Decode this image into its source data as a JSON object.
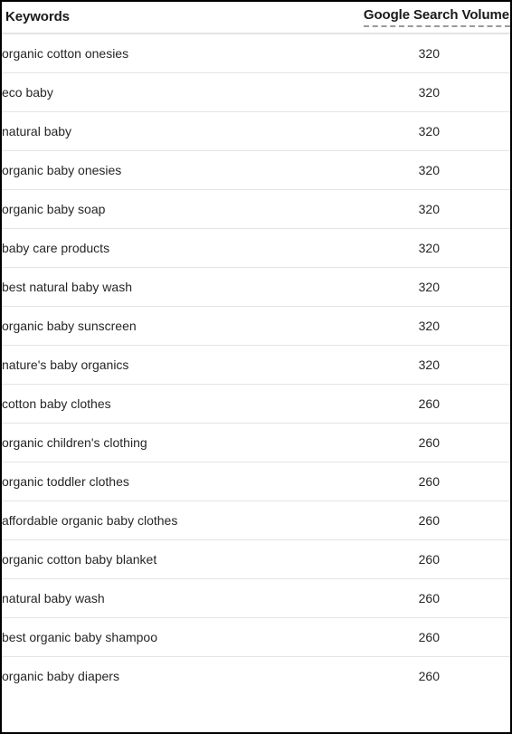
{
  "table": {
    "columns": [
      {
        "key": "keyword",
        "label": "Keywords",
        "align": "left"
      },
      {
        "key": "volume",
        "label": "Google Search Volume",
        "align": "center"
      }
    ],
    "header": {
      "keywords_label": "Keywords",
      "volume_label": "Google Search Volume"
    },
    "rows": [
      {
        "keyword": "organic cotton onesies",
        "volume": "320"
      },
      {
        "keyword": "eco baby",
        "volume": "320"
      },
      {
        "keyword": "natural baby",
        "volume": "320"
      },
      {
        "keyword": "organic baby onesies",
        "volume": "320"
      },
      {
        "keyword": "organic baby soap",
        "volume": "320"
      },
      {
        "keyword": "baby care products",
        "volume": "320"
      },
      {
        "keyword": "best natural baby wash",
        "volume": "320"
      },
      {
        "keyword": "organic baby sunscreen",
        "volume": "320"
      },
      {
        "keyword": "nature's baby organics",
        "volume": "320"
      },
      {
        "keyword": "cotton baby clothes",
        "volume": "260"
      },
      {
        "keyword": "organic children's clothing",
        "volume": "260"
      },
      {
        "keyword": "organic toddler clothes",
        "volume": "260"
      },
      {
        "keyword": "affordable organic baby clothes",
        "volume": "260"
      },
      {
        "keyword": "organic cotton baby blanket",
        "volume": "260"
      },
      {
        "keyword": "natural baby wash",
        "volume": "260"
      },
      {
        "keyword": "best organic baby shampoo",
        "volume": "260"
      },
      {
        "keyword": "organic baby diapers",
        "volume": "260"
      }
    ]
  },
  "colors": {
    "outer_border": "#000000",
    "header_rule": "#e3e3e3",
    "row_rule": "#e4e4e4",
    "header_dashed_underline": "#9a9a9a",
    "text": "#262626",
    "header_text": "#1a1a1a",
    "background": "#ffffff"
  }
}
